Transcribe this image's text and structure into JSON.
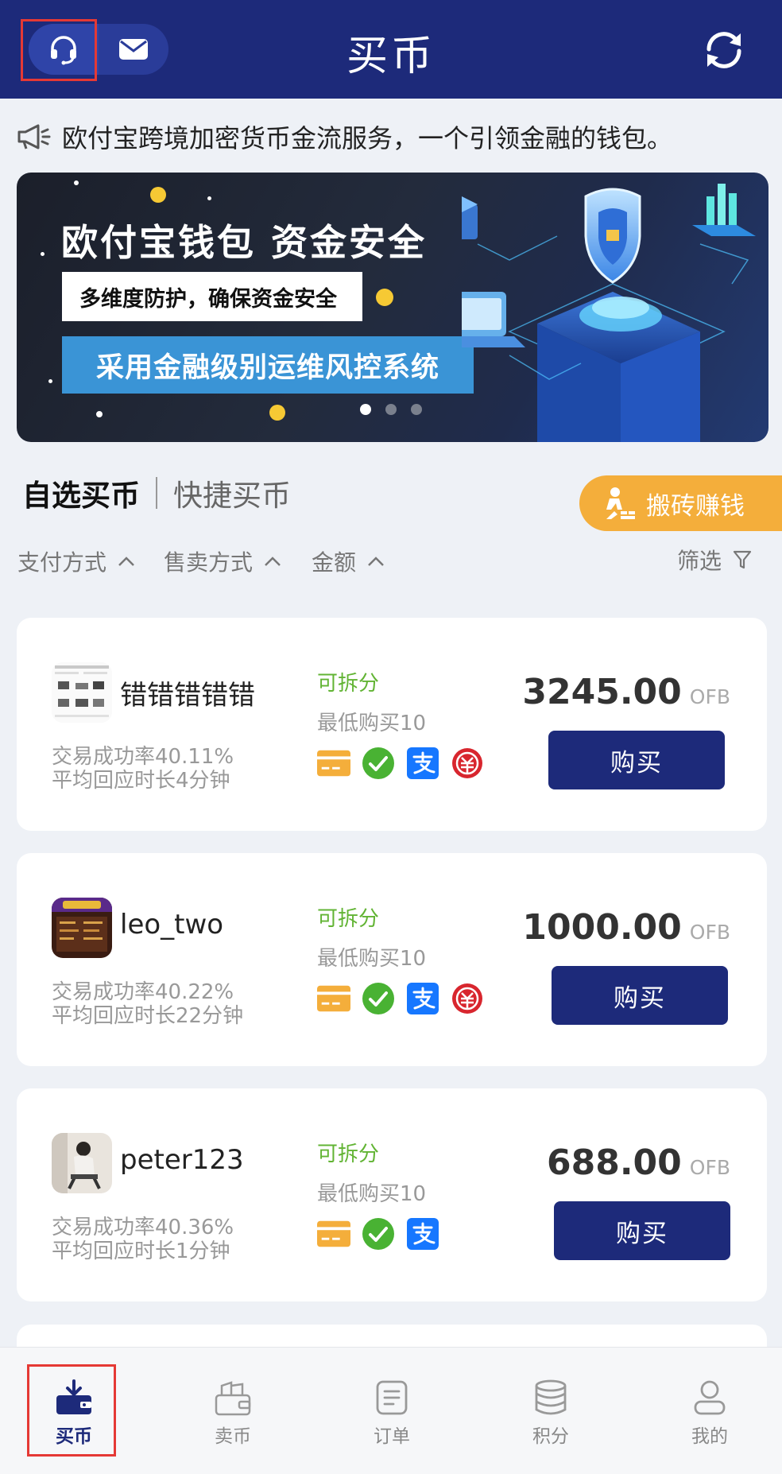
{
  "header": {
    "title": "买币",
    "support_icon": "headset-icon",
    "mail_icon": "mail-icon",
    "refresh_icon": "refresh-icon"
  },
  "notice": {
    "icon": "megaphone-icon",
    "text": "欧付宝跨境加密货币金流服务，一个引领金融的钱包。"
  },
  "banner": {
    "title": "欧付宝钱包  资金安全",
    "tag": "多维度防护，确保资金安全",
    "strip": "采用金融级别运维风控系统",
    "slides": 3,
    "active_slide": 1
  },
  "tabs": {
    "active": "自选买币",
    "other": "快捷买币"
  },
  "earn_button": {
    "label": "搬砖赚钱",
    "icon": "worker-icon",
    "color": "#f4ae3b"
  },
  "filters": {
    "payment": "支付方式",
    "sale": "售卖方式",
    "amount": "金额",
    "filter": "筛选"
  },
  "listings": [
    {
      "name": "错错错错错",
      "success_rate": "交易成功率40.11%",
      "response": "平均回应时长4分钟",
      "splittable": "可拆分",
      "min_buy": "最低购买10",
      "price": "3245.00",
      "unit": "OFB",
      "buy_label": "购买",
      "payments": [
        "bank-card-icon",
        "wechat-pay-icon",
        "alipay-icon",
        "unionpay-icon"
      ]
    },
    {
      "name": "leo_two",
      "success_rate": "交易成功率40.22%",
      "response": "平均回应时长22分钟",
      "splittable": "可拆分",
      "min_buy": "最低购买10",
      "price": "1000.00",
      "unit": "OFB",
      "buy_label": "购买",
      "payments": [
        "bank-card-icon",
        "wechat-pay-icon",
        "alipay-icon",
        "unionpay-icon"
      ]
    },
    {
      "name": "peter123",
      "success_rate": "交易成功率40.36%",
      "response": "平均回应时长1分钟",
      "splittable": "可拆分",
      "min_buy": "最低购买10",
      "price": "688.00",
      "unit": "OFB",
      "buy_label": "购买",
      "payments": [
        "bank-card-icon",
        "wechat-pay-icon",
        "alipay-icon"
      ]
    }
  ],
  "bottom_nav": [
    {
      "label": "买币",
      "icon": "buy-coin-icon",
      "active": true
    },
    {
      "label": "卖币",
      "icon": "sell-coin-icon",
      "active": false
    },
    {
      "label": "订单",
      "icon": "order-icon",
      "active": false
    },
    {
      "label": "积分",
      "icon": "points-icon",
      "active": false
    },
    {
      "label": "我的",
      "icon": "profile-icon",
      "active": false
    }
  ],
  "colors": {
    "primary": "#1d2a7a",
    "accent_orange": "#f4ae3b",
    "green": "#62b434",
    "highlight": "#e53935"
  }
}
